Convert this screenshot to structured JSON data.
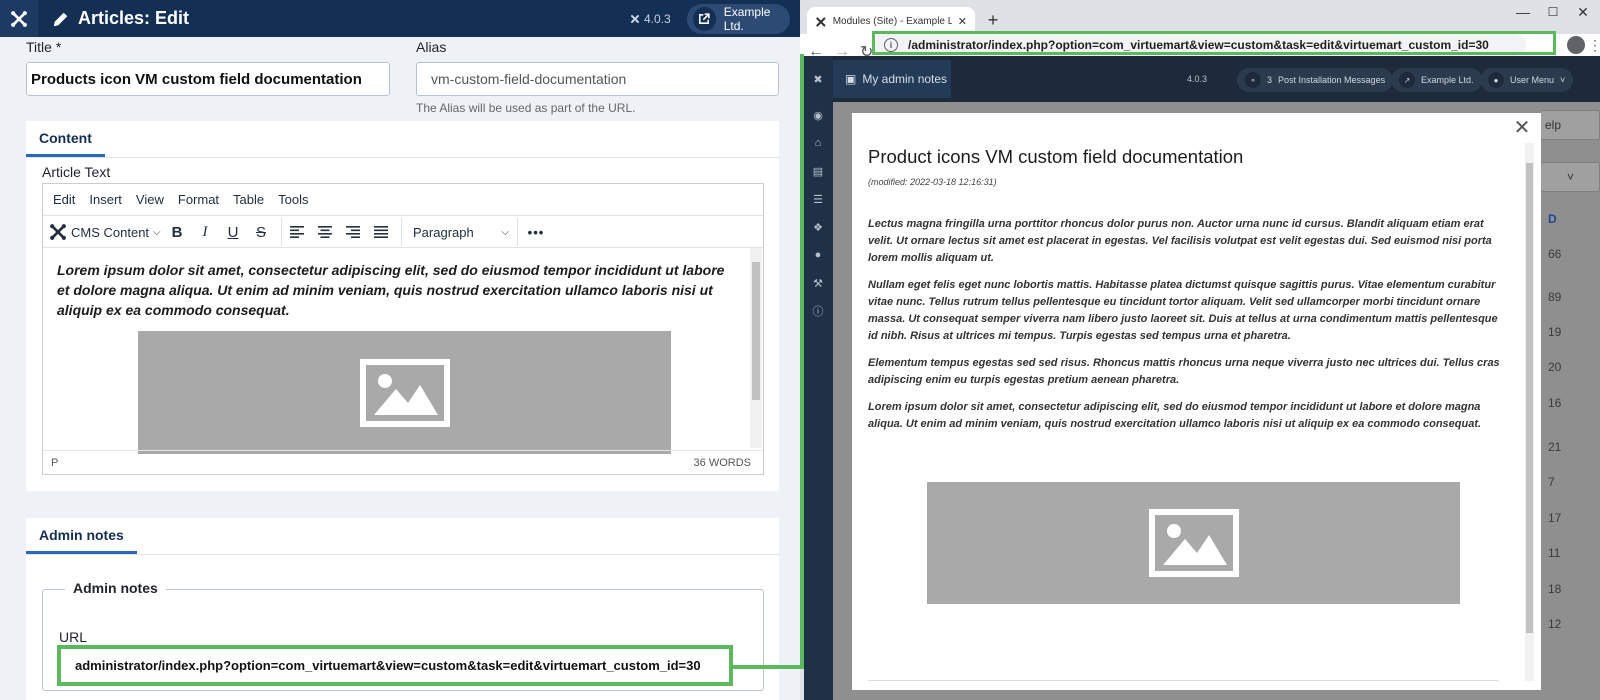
{
  "left": {
    "header": {
      "title": "Articles: Edit",
      "version": "4.0.3",
      "site_label": "Example Ltd."
    },
    "title_label": "Title *",
    "title_value": "Products icon VM custom field documentation",
    "alias_label": "Alias",
    "alias_value": "vm-custom-field-documentation",
    "alias_help": "The Alias will be used as part of the URL.",
    "content_tab": "Content",
    "article_text_label": "Article Text",
    "editor": {
      "menu": [
        "Edit",
        "Insert",
        "View",
        "Format",
        "Table",
        "Tools"
      ],
      "cms_content": "CMS Content",
      "paragraph": "Paragraph",
      "text": "Lorem ipsum dolor sit amet, consectetur adipiscing elit, sed do eiusmod tempor incididunt ut labore et dolore magna aliqua. Ut enim ad minim veniam, quis nostrud exercitation ullamco laboris nisi ut aliquip ex ea commodo consequat.",
      "status_path": "P",
      "word_count": "36 WORDS"
    },
    "admin_notes_tab": "Admin notes",
    "admin_notes_legend": "Admin notes",
    "url_label": "URL",
    "url_value": "administrator/index.php?option=com_virtuemart&view=custom&task=edit&virtuemart_custom_id=30"
  },
  "right": {
    "browser_tab_title": "Modules (Site) - Example Ltd. - A",
    "new_tab": "+",
    "address": "/administrator/index.php?option=com_virtuemart&view=custom&task=edit&virtuemart_custom_id=30",
    "inner": {
      "admin_notes_btn": "My admin notes",
      "version": "4.0.3",
      "messages_count": "3",
      "messages_label": "Post Installation Messages",
      "site_label": "Example Ltd.",
      "user_menu": "User Menu",
      "help_partial": "elp",
      "id_partial": "D",
      "row_numbers": [
        "66",
        "89",
        "19",
        "20",
        "16",
        "21",
        "7",
        "17",
        "11",
        "18",
        "12"
      ]
    },
    "modal": {
      "title": "Product icons VM custom field documentation",
      "modified": "(modified: 2022-03-18 12:16:31)",
      "paragraphs": [
        "Lectus magna fringilla urna porttitor rhoncus dolor purus non. Auctor urna nunc id cursus. Blandit aliquam etiam erat velit. Ut ornare lectus sit amet est placerat in egestas. Vel facilisis volutpat est velit egestas dui. Sed euismod nisi porta lorem mollis aliquam ut.",
        "Nullam eget felis eget nunc lobortis mattis. Habitasse platea dictumst quisque sagittis purus. Vitae elementum curabitur vitae nunc. Tellus rutrum tellus pellentesque eu tincidunt tortor aliquam. Velit sed ullamcorper morbi tincidunt ornare massa. Ut consequat semper viverra nam libero justo laoreet sit. Duis at tellus at urna condimentum mattis pellentesque id nibh. Risus at ultrices mi tempus. Turpis egestas sed tempus urna et pharetra.",
        "Elementum tempus egestas sed sed risus. Rhoncus mattis rhoncus urna neque viverra justo nec ultrices dui. Tellus cras adipiscing enim eu turpis egestas pretium aenean pharetra.",
        "Lorem ipsum dolor sit amet, consectetur adipiscing elit, sed do eiusmod tempor incididunt ut labore et dolore magna aliqua. Ut enim ad minim veniam, quis nostrud exercitation ullamco laboris nisi ut aliquip ex ea commodo consequat."
      ]
    }
  },
  "colors": {
    "highlight": "#5cb85c",
    "header": "#132f53",
    "accent": "#2a69b8"
  },
  "icons": [
    "joomla-logo-icon",
    "pencil-icon",
    "external-link-icon",
    "bold-icon",
    "italic-icon",
    "underline-icon",
    "strikethrough-icon",
    "align-left-icon",
    "align-center-icon",
    "align-right-icon",
    "align-justify-icon",
    "more-icon",
    "image-placeholder-icon",
    "close-icon",
    "back-icon",
    "forward-icon",
    "reload-icon",
    "info-icon",
    "bell-icon",
    "user-icon",
    "book-icon"
  ]
}
